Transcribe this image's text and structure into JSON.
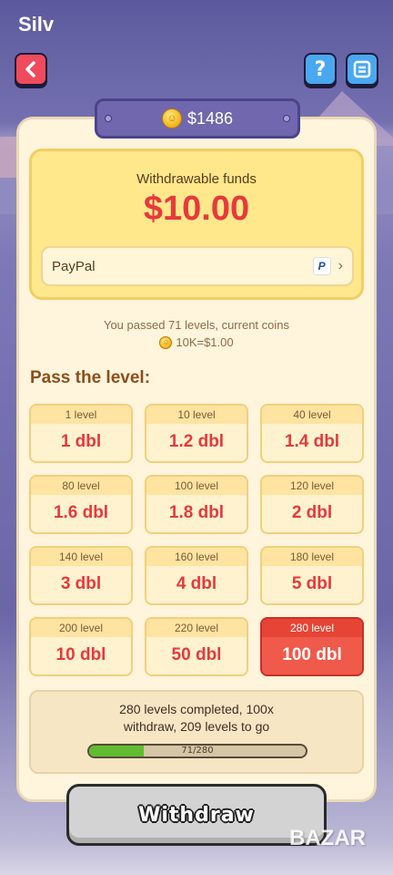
{
  "app": {
    "title": "Silv"
  },
  "toolbar": {
    "back_icon": "back-arrow-icon",
    "help_icon": "help-icon",
    "menu_icon": "menu-icon"
  },
  "balance": {
    "amount": "$1486",
    "icon": "coin-icon"
  },
  "funds": {
    "label": "Withdrawable funds",
    "amount": "$10.00",
    "method": "PayPal",
    "method_icon": "paypal-icon"
  },
  "progress": {
    "line1": "You passed 71 levels, current coins",
    "rate": "10K=$1.00"
  },
  "pass_title": "Pass the level:",
  "levels": [
    {
      "level": "1 level",
      "reward": "1 dbl"
    },
    {
      "level": "10 level",
      "reward": "1.2 dbl"
    },
    {
      "level": "40 level",
      "reward": "1.4 dbl"
    },
    {
      "level": "80 level",
      "reward": "1.6 dbl"
    },
    {
      "level": "100 level",
      "reward": "1.8 dbl"
    },
    {
      "level": "120 level",
      "reward": "2 dbl"
    },
    {
      "level": "140 level",
      "reward": "3 dbl"
    },
    {
      "level": "160 level",
      "reward": "4 dbl"
    },
    {
      "level": "180 level",
      "reward": "5 dbl"
    },
    {
      "level": "200 level",
      "reward": "10 dbl"
    },
    {
      "level": "220 level",
      "reward": "50 dbl"
    },
    {
      "level": "280 level",
      "reward": "100 dbl",
      "active": true
    }
  ],
  "status": {
    "line1": "280 levels completed, 100x",
    "line2": "withdraw, 209 levels to go",
    "bar_label": "71/280",
    "bar_fraction": 0.254
  },
  "withdraw_label": "Withdraw",
  "watermark": "BAZAR",
  "colors": {
    "accent_red": "#e6393c",
    "panel_yellow": "#ffe78c",
    "progress_green": "#5fbd2f",
    "banner_purple": "#7067ae"
  }
}
